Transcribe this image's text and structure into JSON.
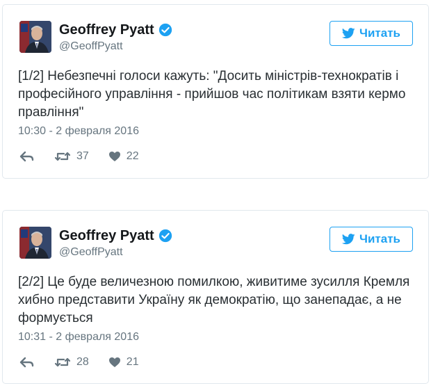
{
  "colors": {
    "accent": "#1da1f2",
    "text": "#292f33",
    "muted": "#66757f",
    "border": "#e1e8ed"
  },
  "tweets": [
    {
      "author_name": "Geoffrey Pyatt",
      "handle": "@GeoffPyatt",
      "follow_label": "Читать",
      "text": "[1/2] Небезпечні голоси кажуть: \"Досить міністрів-технократів і професійного управління - прийшов час політикам взяти кермо правління\"",
      "timestamp": "10:30 - 2 февраля 2016",
      "retweets": "37",
      "likes": "22",
      "icons": [
        "avatar",
        "verified-badge-icon",
        "twitter-bird-icon",
        "reply-icon",
        "retweet-icon",
        "heart-icon"
      ]
    },
    {
      "author_name": "Geoffrey Pyatt",
      "handle": "@GeoffPyatt",
      "follow_label": "Читать",
      "text": "[2/2] Це буде величезною помилкою, живитиме зусилля Кремля хибно представити Україну як демократію, що занепадає, а не формується",
      "timestamp": "10:31 - 2 февраля 2016",
      "retweets": "28",
      "likes": "21",
      "icons": [
        "avatar",
        "verified-badge-icon",
        "twitter-bird-icon",
        "reply-icon",
        "retweet-icon",
        "heart-icon"
      ]
    }
  ]
}
